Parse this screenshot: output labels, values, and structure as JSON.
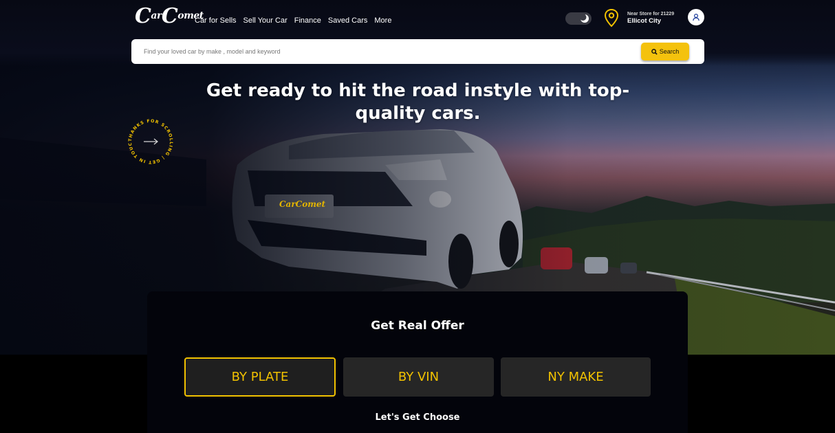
{
  "brand": {
    "logo_text": "CarComet",
    "logo_prefix": "C",
    "logo_mid": "ar",
    "logo_c2": "C",
    "logo_suffix": "omet"
  },
  "nav": {
    "items": [
      "Car for Sells",
      "Sell Your Car",
      "Finance",
      "Saved Cars",
      "More"
    ]
  },
  "header": {
    "store_label": "Near Store for 21229",
    "store_city": "Ellicot City"
  },
  "search": {
    "placeholder": "Find your loved car by make , model and keyword",
    "button_label": "Search"
  },
  "hero": {
    "headline": "Get ready to hit the road instyle with top-quality cars.",
    "badge_text": "THANKS FOR SCROLLING | GET IN TOUCH •",
    "plate_text": "CarComet"
  },
  "offer": {
    "title": "Get Real Offer",
    "tabs": [
      "BY PLATE",
      "BY VIN",
      "NY MAKE"
    ],
    "active_tab": "BY PLATE",
    "subtitle": "Let's Get Choose"
  },
  "colors": {
    "accent": "#f2c200",
    "background": "#000000",
    "card": "#03040b",
    "tab_bg": "#262626"
  },
  "icons": [
    "moon-icon",
    "location-pin-icon",
    "user-icon",
    "search-icon",
    "arrow-right-icon"
  ]
}
